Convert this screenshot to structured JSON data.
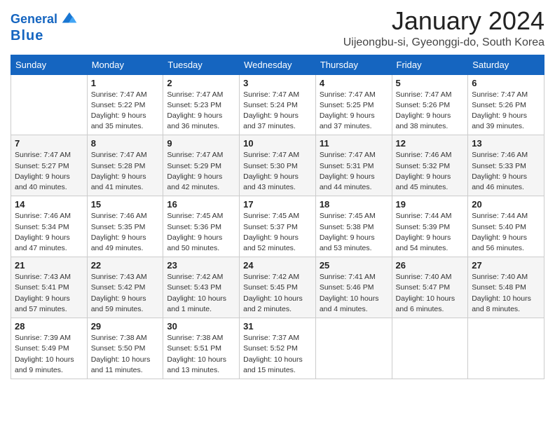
{
  "header": {
    "logo_line1": "General",
    "logo_line2": "Blue",
    "month_title": "January 2024",
    "location": "Uijeongbu-si, Gyeonggi-do, South Korea"
  },
  "weekdays": [
    "Sunday",
    "Monday",
    "Tuesday",
    "Wednesday",
    "Thursday",
    "Friday",
    "Saturday"
  ],
  "weeks": [
    [
      {
        "day": "",
        "sunrise": "",
        "sunset": "",
        "daylight": ""
      },
      {
        "day": "1",
        "sunrise": "Sunrise: 7:47 AM",
        "sunset": "Sunset: 5:22 PM",
        "daylight": "Daylight: 9 hours and 35 minutes."
      },
      {
        "day": "2",
        "sunrise": "Sunrise: 7:47 AM",
        "sunset": "Sunset: 5:23 PM",
        "daylight": "Daylight: 9 hours and 36 minutes."
      },
      {
        "day": "3",
        "sunrise": "Sunrise: 7:47 AM",
        "sunset": "Sunset: 5:24 PM",
        "daylight": "Daylight: 9 hours and 37 minutes."
      },
      {
        "day": "4",
        "sunrise": "Sunrise: 7:47 AM",
        "sunset": "Sunset: 5:25 PM",
        "daylight": "Daylight: 9 hours and 37 minutes."
      },
      {
        "day": "5",
        "sunrise": "Sunrise: 7:47 AM",
        "sunset": "Sunset: 5:26 PM",
        "daylight": "Daylight: 9 hours and 38 minutes."
      },
      {
        "day": "6",
        "sunrise": "Sunrise: 7:47 AM",
        "sunset": "Sunset: 5:26 PM",
        "daylight": "Daylight: 9 hours and 39 minutes."
      }
    ],
    [
      {
        "day": "7",
        "sunrise": "Sunrise: 7:47 AM",
        "sunset": "Sunset: 5:27 PM",
        "daylight": "Daylight: 9 hours and 40 minutes."
      },
      {
        "day": "8",
        "sunrise": "Sunrise: 7:47 AM",
        "sunset": "Sunset: 5:28 PM",
        "daylight": "Daylight: 9 hours and 41 minutes."
      },
      {
        "day": "9",
        "sunrise": "Sunrise: 7:47 AM",
        "sunset": "Sunset: 5:29 PM",
        "daylight": "Daylight: 9 hours and 42 minutes."
      },
      {
        "day": "10",
        "sunrise": "Sunrise: 7:47 AM",
        "sunset": "Sunset: 5:30 PM",
        "daylight": "Daylight: 9 hours and 43 minutes."
      },
      {
        "day": "11",
        "sunrise": "Sunrise: 7:47 AM",
        "sunset": "Sunset: 5:31 PM",
        "daylight": "Daylight: 9 hours and 44 minutes."
      },
      {
        "day": "12",
        "sunrise": "Sunrise: 7:46 AM",
        "sunset": "Sunset: 5:32 PM",
        "daylight": "Daylight: 9 hours and 45 minutes."
      },
      {
        "day": "13",
        "sunrise": "Sunrise: 7:46 AM",
        "sunset": "Sunset: 5:33 PM",
        "daylight": "Daylight: 9 hours and 46 minutes."
      }
    ],
    [
      {
        "day": "14",
        "sunrise": "Sunrise: 7:46 AM",
        "sunset": "Sunset: 5:34 PM",
        "daylight": "Daylight: 9 hours and 47 minutes."
      },
      {
        "day": "15",
        "sunrise": "Sunrise: 7:46 AM",
        "sunset": "Sunset: 5:35 PM",
        "daylight": "Daylight: 9 hours and 49 minutes."
      },
      {
        "day": "16",
        "sunrise": "Sunrise: 7:45 AM",
        "sunset": "Sunset: 5:36 PM",
        "daylight": "Daylight: 9 hours and 50 minutes."
      },
      {
        "day": "17",
        "sunrise": "Sunrise: 7:45 AM",
        "sunset": "Sunset: 5:37 PM",
        "daylight": "Daylight: 9 hours and 52 minutes."
      },
      {
        "day": "18",
        "sunrise": "Sunrise: 7:45 AM",
        "sunset": "Sunset: 5:38 PM",
        "daylight": "Daylight: 9 hours and 53 minutes."
      },
      {
        "day": "19",
        "sunrise": "Sunrise: 7:44 AM",
        "sunset": "Sunset: 5:39 PM",
        "daylight": "Daylight: 9 hours and 54 minutes."
      },
      {
        "day": "20",
        "sunrise": "Sunrise: 7:44 AM",
        "sunset": "Sunset: 5:40 PM",
        "daylight": "Daylight: 9 hours and 56 minutes."
      }
    ],
    [
      {
        "day": "21",
        "sunrise": "Sunrise: 7:43 AM",
        "sunset": "Sunset: 5:41 PM",
        "daylight": "Daylight: 9 hours and 57 minutes."
      },
      {
        "day": "22",
        "sunrise": "Sunrise: 7:43 AM",
        "sunset": "Sunset: 5:42 PM",
        "daylight": "Daylight: 9 hours and 59 minutes."
      },
      {
        "day": "23",
        "sunrise": "Sunrise: 7:42 AM",
        "sunset": "Sunset: 5:43 PM",
        "daylight": "Daylight: 10 hours and 1 minute."
      },
      {
        "day": "24",
        "sunrise": "Sunrise: 7:42 AM",
        "sunset": "Sunset: 5:45 PM",
        "daylight": "Daylight: 10 hours and 2 minutes."
      },
      {
        "day": "25",
        "sunrise": "Sunrise: 7:41 AM",
        "sunset": "Sunset: 5:46 PM",
        "daylight": "Daylight: 10 hours and 4 minutes."
      },
      {
        "day": "26",
        "sunrise": "Sunrise: 7:40 AM",
        "sunset": "Sunset: 5:47 PM",
        "daylight": "Daylight: 10 hours and 6 minutes."
      },
      {
        "day": "27",
        "sunrise": "Sunrise: 7:40 AM",
        "sunset": "Sunset: 5:48 PM",
        "daylight": "Daylight: 10 hours and 8 minutes."
      }
    ],
    [
      {
        "day": "28",
        "sunrise": "Sunrise: 7:39 AM",
        "sunset": "Sunset: 5:49 PM",
        "daylight": "Daylight: 10 hours and 9 minutes."
      },
      {
        "day": "29",
        "sunrise": "Sunrise: 7:38 AM",
        "sunset": "Sunset: 5:50 PM",
        "daylight": "Daylight: 10 hours and 11 minutes."
      },
      {
        "day": "30",
        "sunrise": "Sunrise: 7:38 AM",
        "sunset": "Sunset: 5:51 PM",
        "daylight": "Daylight: 10 hours and 13 minutes."
      },
      {
        "day": "31",
        "sunrise": "Sunrise: 7:37 AM",
        "sunset": "Sunset: 5:52 PM",
        "daylight": "Daylight: 10 hours and 15 minutes."
      },
      {
        "day": "",
        "sunrise": "",
        "sunset": "",
        "daylight": ""
      },
      {
        "day": "",
        "sunrise": "",
        "sunset": "",
        "daylight": ""
      },
      {
        "day": "",
        "sunrise": "",
        "sunset": "",
        "daylight": ""
      }
    ]
  ]
}
